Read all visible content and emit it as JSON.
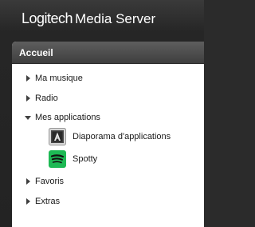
{
  "header": {
    "brand_logo": "Logitech",
    "brand_product": "Media Server"
  },
  "panel": {
    "title": "Accueil"
  },
  "menu": {
    "items": [
      {
        "label": "Ma musique",
        "expanded": false,
        "icon": "triangle-right"
      },
      {
        "label": "Radio",
        "expanded": false,
        "icon": "triangle-right"
      },
      {
        "label": "Mes applications",
        "expanded": true,
        "icon": "triangle-down"
      },
      {
        "label": "Favoris",
        "expanded": false,
        "icon": "triangle-right"
      },
      {
        "label": "Extras",
        "expanded": false,
        "icon": "triangle-right"
      }
    ],
    "apps": [
      {
        "label": "Diaporama d'applications",
        "icon": "app-slideshow-icon"
      },
      {
        "label": "Spotty",
        "icon": "spotify-icon"
      }
    ]
  },
  "colors": {
    "background": "#2b2b2b",
    "title_bar": "#4a4a4a",
    "panel": "#ffffff",
    "spotify_green": "#1db954"
  }
}
